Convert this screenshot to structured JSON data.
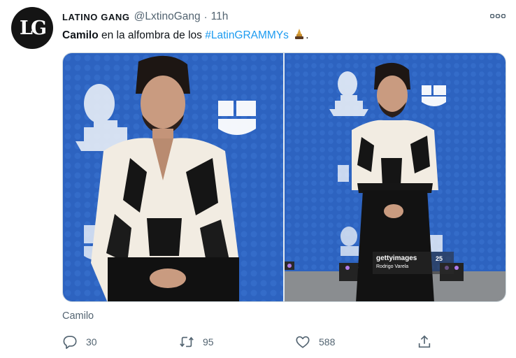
{
  "tweet": {
    "avatar_text": "LG",
    "display_name": "LATINO GANG",
    "handle": "@LxtinoGang",
    "separator": "·",
    "time": "11h",
    "text": {
      "mention": "Camilo",
      "middle": " en la alfombra de los ",
      "hashtag": "#LatinGRAMMYs",
      "end": "."
    },
    "emoji_icon": "gramophone-trophy-icon",
    "more_icon": "more-dots-icon",
    "media": {
      "watermark_brand": "gettyimages",
      "watermark_credit": "Rodrigo Varela",
      "watermark_badge": "25"
    },
    "caption": "Camilo",
    "actions": {
      "reply": {
        "icon": "reply-icon",
        "count": "30"
      },
      "retweet": {
        "icon": "retweet-icon",
        "count": "95"
      },
      "like": {
        "icon": "heart-icon",
        "count": "588"
      },
      "share": {
        "icon": "share-icon"
      }
    }
  },
  "colors": {
    "link": "#1d9bf0",
    "secondary_text": "#536471",
    "backdrop_blue": "#2f67c4"
  }
}
